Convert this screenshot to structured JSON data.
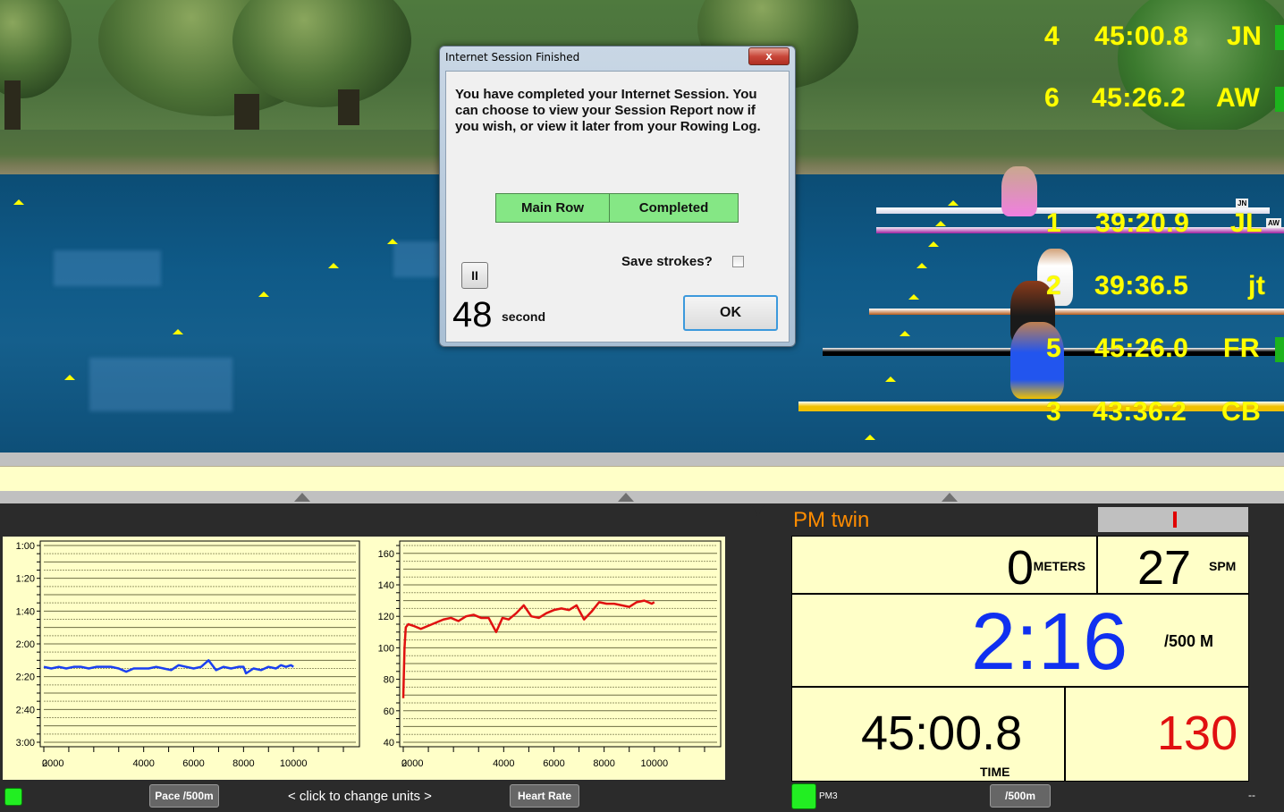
{
  "scene": {
    "leaderboard": [
      {
        "place": "4",
        "time": "45:00.8",
        "name": "JN",
        "status_color": "#1db31d"
      },
      {
        "place": "6",
        "time": "45:26.2",
        "name": "AW",
        "status_color": "#1db31d"
      },
      {
        "place": "1",
        "time": "39:20.9",
        "name": "JL"
      },
      {
        "place": "2",
        "time": "39:36.5",
        "name": "jt"
      },
      {
        "place": "5",
        "time": "45:26.0",
        "name": "FR",
        "status_color": "#1db31d"
      },
      {
        "place": "3",
        "time": "43:36.2",
        "name": "CB"
      }
    ],
    "boat_tags": [
      "JN",
      "AW"
    ],
    "hud_color": "#ffff00"
  },
  "dialog": {
    "title": "Internet Session Finished",
    "close_label": "x",
    "message": "You have completed your Internet Session. You can choose to view your Session Report now if you wish, or view it later from your Rowing Log.",
    "status_row": {
      "session": "Main Row",
      "state": "Completed"
    },
    "save_strokes_label": "Save strokes?",
    "save_strokes_checked": false,
    "pause_label": "II",
    "countdown_value": "48",
    "countdown_unit": "second",
    "ok_label": "OK"
  },
  "chart_panel": {
    "left_button": "Pace /500m",
    "units_hint": "<  click to change units  >",
    "right_button": "Heart Rate",
    "led_color": "#22ee22"
  },
  "chart_data": [
    {
      "type": "line",
      "title": "",
      "xlabel": "",
      "ylabel": "Pace /500m",
      "y_tick_labels": [
        "1:00",
        "1:20",
        "1:40",
        "2:00",
        "2:20",
        "2:40",
        "3:00"
      ],
      "y_ticks_seconds": [
        60,
        80,
        100,
        120,
        140,
        160,
        180
      ],
      "ylim_seconds": [
        180,
        60
      ],
      "y_inverted": true,
      "x_tick_labels": [
        "0",
        "2000",
        "4000",
        "6000",
        "8000",
        "10000"
      ],
      "x_ticks": [
        0,
        2000,
        4000,
        6000,
        8000,
        10000
      ],
      "xlim": [
        0,
        12500
      ],
      "grid": true,
      "series": [
        {
          "name": "Pace",
          "color": "#1a3ff0",
          "x": [
            0,
            300,
            600,
            900,
            1200,
            1500,
            1800,
            2100,
            2400,
            2700,
            3000,
            3300,
            3600,
            3900,
            4200,
            4500,
            4800,
            5100,
            5400,
            5700,
            6000,
            6300,
            6600,
            6900,
            7200,
            7500,
            7800,
            8000,
            8100,
            8400,
            8700,
            9000,
            9300,
            9500,
            9700,
            9900,
            10000
          ],
          "y": [
            134,
            135,
            134,
            135,
            134,
            134,
            135,
            134,
            134,
            134,
            135,
            137,
            135,
            135,
            135,
            134,
            135,
            136,
            133,
            134,
            135,
            134,
            130,
            136,
            134,
            135,
            134,
            134,
            138,
            135,
            136,
            134,
            135,
            133,
            134,
            133,
            134
          ]
        }
      ]
    },
    {
      "type": "line",
      "title": "",
      "xlabel": "",
      "ylabel": "Heart Rate",
      "y_ticks": [
        40,
        60,
        80,
        100,
        120,
        140,
        160
      ],
      "ylim": [
        40,
        165
      ],
      "x_tick_labels": [
        "0",
        "2000",
        "4000",
        "6000",
        "8000",
        "10000"
      ],
      "x_ticks": [
        0,
        2000,
        4000,
        6000,
        8000,
        10000
      ],
      "xlim": [
        0,
        12500
      ],
      "grid": true,
      "series": [
        {
          "name": "Heart Rate",
          "color": "#e01010",
          "x": [
            0,
            50,
            100,
            200,
            400,
            700,
            1000,
            1300,
            1600,
            1900,
            2200,
            2500,
            2800,
            3100,
            3400,
            3700,
            3950,
            4200,
            4500,
            4800,
            5100,
            5400,
            5700,
            6000,
            6300,
            6600,
            6900,
            7200,
            7500,
            7800,
            8100,
            8400,
            8700,
            9000,
            9300,
            9600,
            9900,
            10000
          ],
          "y": [
            68,
            100,
            113,
            115,
            114,
            112,
            114,
            116,
            118,
            119,
            117,
            120,
            121,
            119,
            119,
            110,
            119,
            118,
            122,
            127,
            120,
            119,
            122,
            124,
            125,
            124,
            127,
            118,
            123,
            129,
            128,
            128,
            127,
            126,
            129,
            130,
            128,
            129
          ]
        }
      ]
    }
  ],
  "pm_panel": {
    "title": "PM twin",
    "meters_value": "0",
    "meters_unit": "METERS",
    "spm_value": "27",
    "spm_unit": "SPM",
    "pace_value": "2:16",
    "pace_unit": "/500 M",
    "time_value": "45:00.8",
    "time_unit": "TIME",
    "heart_rate_value": "130",
    "monitor_label": "PM3",
    "units_button": "/500m",
    "status_text": "--",
    "pace_color": "#1030f0",
    "hr_color": "#e01010",
    "title_color": "#ff8c00"
  }
}
